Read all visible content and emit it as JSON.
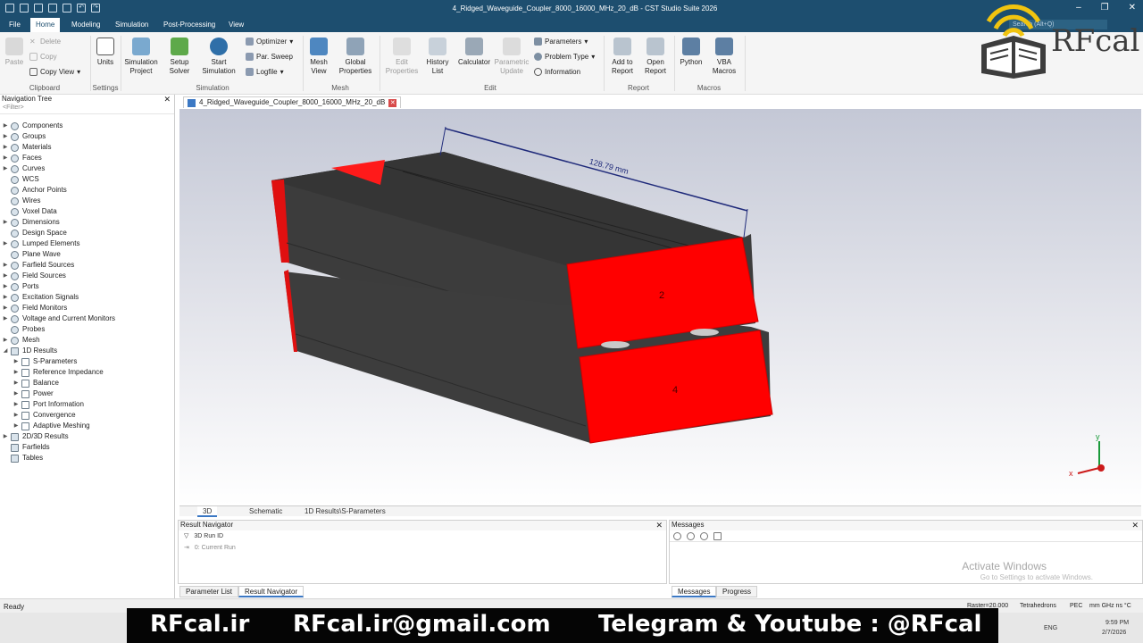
{
  "window": {
    "title": "4_Ridged_Waveguide_Coupler_8000_16000_MHz_20_dB - CST Studio Suite 2026",
    "search_placeholder": "Search (Alt+Q)"
  },
  "menu": [
    "File",
    "Home",
    "Modeling",
    "Simulation",
    "Post-Processing",
    "View"
  ],
  "menu_active": "Home",
  "ribbon": {
    "clipboard": {
      "paste": "Paste",
      "delete": "Delete",
      "copy": "Copy",
      "copy_view": "Copy View",
      "label": "Clipboard"
    },
    "settings": {
      "units": "Units",
      "label": "Settings"
    },
    "simulation": {
      "sim_project_1": "Simulation",
      "sim_project_2": "Project",
      "setup_solver_1": "Setup",
      "setup_solver_2": "Solver",
      "start_sim_1": "Start",
      "start_sim_2": "Simulation",
      "optimizer": "Optimizer",
      "par_sweep": "Par. Sweep",
      "logfile": "Logfile",
      "label": "Simulation"
    },
    "mesh": {
      "mesh_view_1": "Mesh",
      "mesh_view_2": "View",
      "global_props_1": "Global",
      "global_props_2": "Properties",
      "label": "Mesh"
    },
    "edit": {
      "edit_props_1": "Edit",
      "edit_props_2": "Properties",
      "history_1": "History",
      "history_2": "List",
      "calculator": "Calculator",
      "param_update_1": "Parametric",
      "param_update_2": "Update",
      "parameters": "Parameters",
      "problem_type": "Problem Type",
      "information": "Information",
      "label": "Edit"
    },
    "report": {
      "add_1": "Add to",
      "add_2": "Report",
      "open_1": "Open",
      "open_2": "Report",
      "label": "Report"
    },
    "macros": {
      "python": "Python",
      "vba_1": "VBA",
      "vba_2": "Macros",
      "label": "Macros"
    }
  },
  "nav": {
    "title": "Navigation Tree",
    "filter": "<Filter>",
    "items": [
      "Components",
      "Groups",
      "Materials",
      "Faces",
      "Curves",
      "WCS",
      "Anchor Points",
      "Wires",
      "Voxel Data",
      "Dimensions",
      "Design Space",
      "Lumped Elements",
      "Plane Wave",
      "Farfield Sources",
      "Field Sources",
      "Ports",
      "Excitation Signals",
      "Field Monitors",
      "Voltage and Current Monitors",
      "Probes",
      "Mesh",
      "1D Results",
      "S-Parameters",
      "Reference Impedance",
      "Balance",
      "Power",
      "Port Information",
      "Convergence",
      "Adaptive Meshing",
      "2D/3D Results",
      "Farfields",
      "Tables"
    ]
  },
  "doc_tab": "4_Ridged_Waveguide_Coupler_8000_16000_MHz_20_dB",
  "viewport": {
    "dimension_label": "128.79 mm",
    "port_2": "2",
    "port_4": "4",
    "axis_y": "y",
    "axis_x": "x"
  },
  "view_tabs": [
    "3D",
    "Schematic",
    "1D Results\\S-Parameters"
  ],
  "result_nav": {
    "title": "Result Navigator",
    "col": "3D Run ID",
    "row": "0: Current Run"
  },
  "messages": {
    "title": "Messages",
    "activate_1": "Activate Windows",
    "activate_2": "Go to Settings to activate Windows."
  },
  "bottom_tabs": {
    "param_list": "Parameter List",
    "result_nav": "Result Navigator",
    "messages": "Messages",
    "progress": "Progress"
  },
  "status": {
    "ready": "Ready",
    "raster": "Raster=20.000",
    "mesh": "Tetrahedrons",
    "pec": "PEC",
    "units": "mm  GHz  ns  °C"
  },
  "taskbar": {
    "lang": "ENG",
    "time": "9:59 PM",
    "date": "2/7/2026"
  },
  "banner": {
    "site": "RFcal.ir",
    "email": "RFcal.ir@gmail.com",
    "social": "Telegram & Youtube : @RFcal"
  },
  "logo": {
    "text": "RFcal"
  },
  "colors": {
    "title_bar": "#1d4e6f",
    "port_red": "#ff0000",
    "body_dark": "#3c3c3c"
  }
}
